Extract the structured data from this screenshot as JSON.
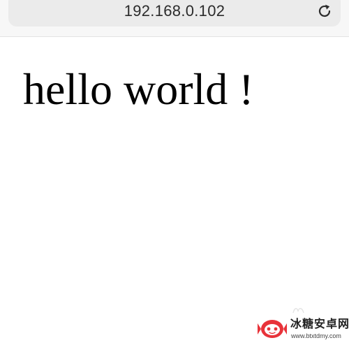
{
  "browser": {
    "url": "192.168.0.102",
    "reload_icon": "reload-icon"
  },
  "page": {
    "heading": "hello world !"
  },
  "watermark": {
    "brand": "冰糖安卓网",
    "url": "www.btxtdmy.com",
    "logo_icon": "candy-logo-icon",
    "accent_color": "#e8333a"
  }
}
